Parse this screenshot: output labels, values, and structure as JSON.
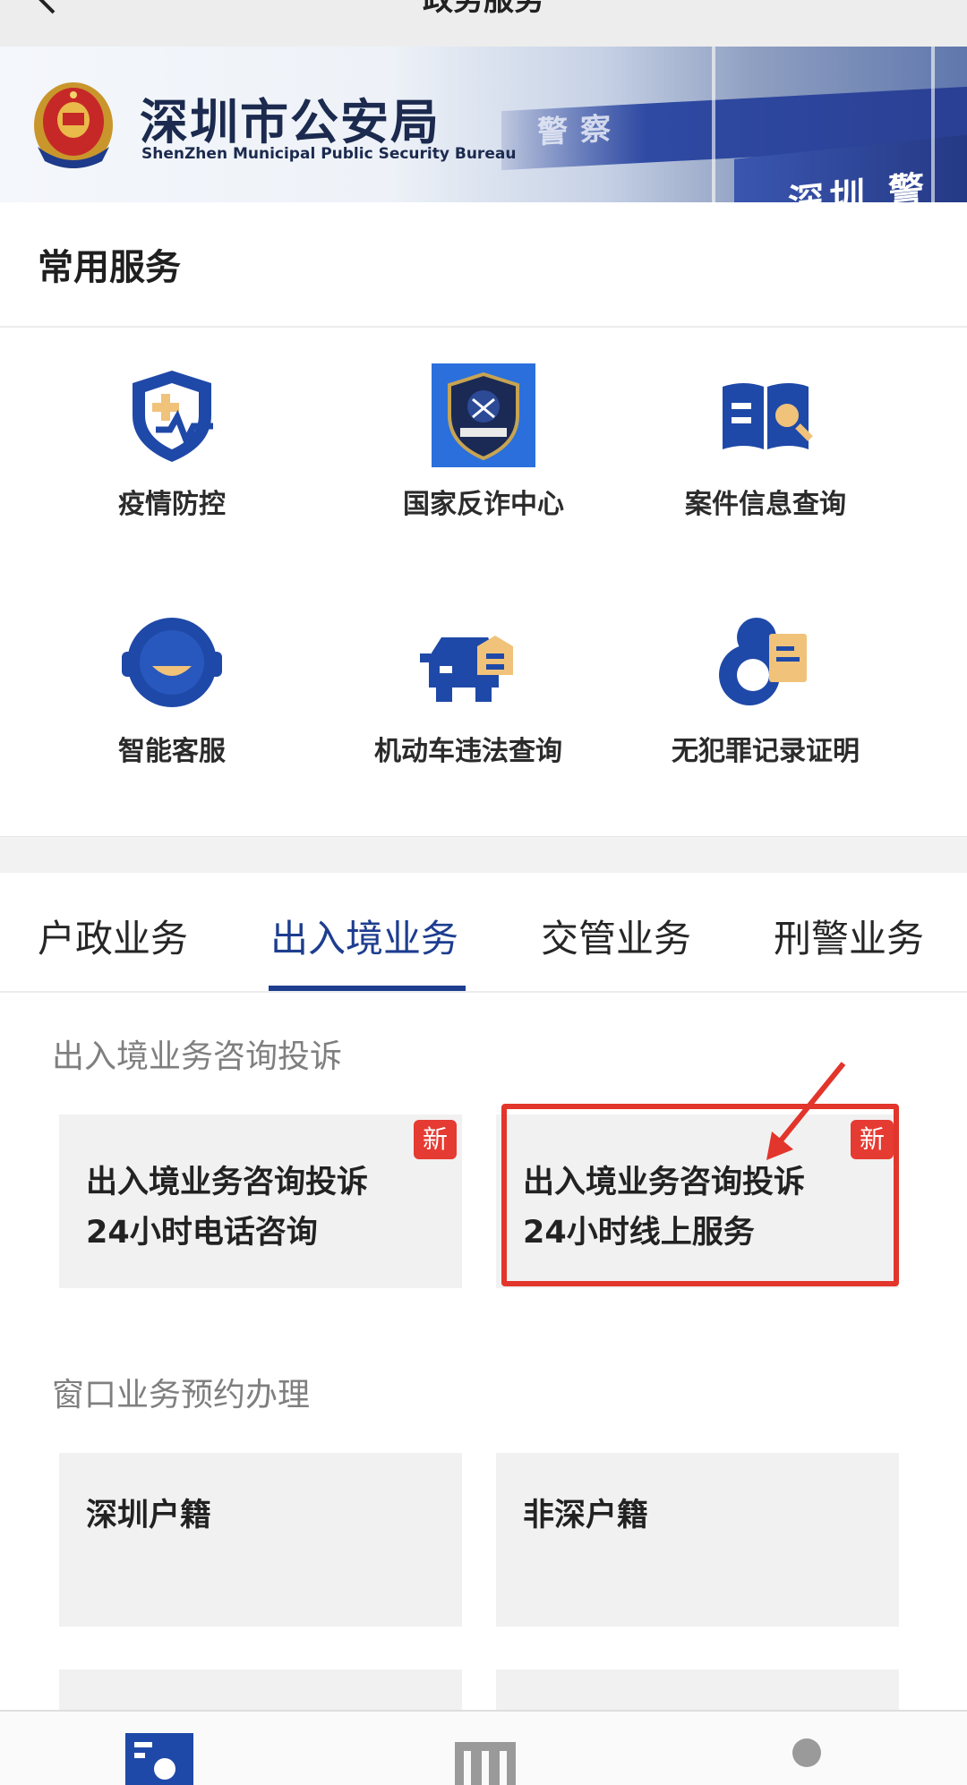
{
  "topbar": {
    "title": "政务服务"
  },
  "banner": {
    "org_name": "深圳市公安局",
    "org_en": "ShenZhen Municipal Public Security Bureau",
    "wall_text_1": "警察",
    "wall_text_2": "深圳 警察"
  },
  "common_services": {
    "heading": "常用服务",
    "items": [
      {
        "label": "疫情防控",
        "icon": "shield-health-icon"
      },
      {
        "label": "国家反诈中心",
        "icon": "anti-fraud-badge-icon"
      },
      {
        "label": "案件信息查询",
        "icon": "book-search-icon"
      },
      {
        "label": "智能客服",
        "icon": "robot-face-icon"
      },
      {
        "label": "机动车违法查询",
        "icon": "car-check-icon"
      },
      {
        "label": "无犯罪记录证明",
        "icon": "certificate-icon"
      }
    ]
  },
  "tabs": [
    {
      "label": "户政业务",
      "active": false
    },
    {
      "label": "出入境业务",
      "active": true
    },
    {
      "label": "交管业务",
      "active": false
    },
    {
      "label": "刑警业务",
      "active": false
    }
  ],
  "sections": [
    {
      "title": "出入境业务咨询投诉",
      "cards": [
        {
          "text": "出入境业务咨询投诉\n24小时电话咨询",
          "badge": "新"
        },
        {
          "text": "出入境业务咨询投诉\n24小时线上服务",
          "badge": "新"
        }
      ]
    },
    {
      "title": "窗口业务预约办理",
      "cards": [
        {
          "text": "深圳户籍"
        },
        {
          "text": "非深户籍"
        }
      ]
    }
  ],
  "colors": {
    "accent": "#1d3d8f",
    "badge": "#e53b32",
    "highlight": "#e2352b",
    "icon_blue": "#1f49a8",
    "icon_gold": "#f0c27a"
  }
}
